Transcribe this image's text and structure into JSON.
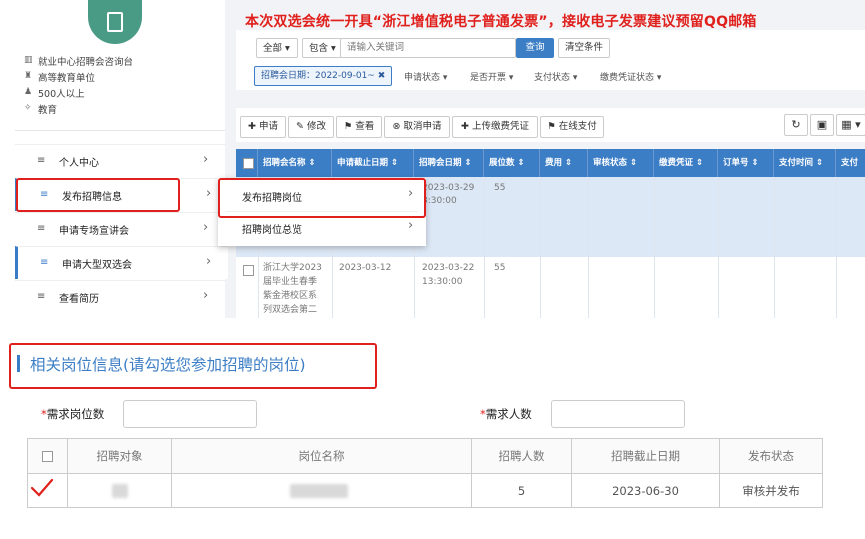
{
  "notice": "本次双选会统一开具“浙江增值税电子普通发票”，接收电子发票建议预留QQ邮箱",
  "sidebar": {
    "info": [
      {
        "icon": "building-icon",
        "glyph": "▥",
        "text": "就业中心招聘会咨询台"
      },
      {
        "icon": "graduation-cap-icon",
        "glyph": "♜",
        "text": "高等教育单位"
      },
      {
        "icon": "people-icon",
        "glyph": "♟",
        "text": "500人以上"
      },
      {
        "icon": "education-icon",
        "glyph": "✧",
        "text": "教育"
      }
    ],
    "menu": [
      {
        "label": "个人中心"
      },
      {
        "label": "发布招聘信息"
      },
      {
        "label": "申请专场宣讲会"
      },
      {
        "label": "申请大型双选会"
      },
      {
        "label": "查看简历"
      }
    ],
    "menu_icon_glyph": "≡",
    "chevron_glyph": "›"
  },
  "submenu": {
    "items": [
      "发布招聘岗位",
      "招聘岗位总览"
    ]
  },
  "search": {
    "scope": "全部 ▾",
    "match": "包含 ▾",
    "placeholder": "请输入关键词",
    "query_button": "查询",
    "clear_button": "清空条件",
    "active_filter": "招聘会日期：2022-09-01~ ✖",
    "filters": [
      "申请状态 ▾",
      "是否开票 ▾",
      "支付状态 ▾",
      "缴费凭证状态 ▾"
    ]
  },
  "toolbar": {
    "buttons": [
      "✚ 申请",
      "✎ 修改",
      "⚑ 查看",
      "⊗ 取消申请",
      "✚ 上传缴费凭证",
      "⚑ 在线支付"
    ],
    "icons": [
      "↻",
      "▣",
      "▦ ▾"
    ]
  },
  "grid": {
    "headers": [
      "招聘会名称",
      "申请截止日期",
      "招聘会日期",
      "展位数",
      "费用",
      "审核状态",
      "缴费凭证",
      "订单号",
      "支付时间",
      "支付"
    ],
    "sort_glyph": "⇕",
    "rows": [
      {
        "name": "",
        "deadline": "",
        "date": "2023-03-29",
        "time": "3:30:00",
        "booths": "55"
      },
      {
        "name": [
          "浙江大学2023",
          "届毕业生春季",
          "紫金港校区系",
          "列双选会第二"
        ],
        "deadline": "2023-03-12",
        "date": "2023-03-22",
        "time": "13:30:00",
        "booths": "55"
      }
    ]
  },
  "positions": {
    "title": "相关岗位信息(请勾选您参加招聘的岗位)",
    "need_position_label": "需求岗位数",
    "need_people_label": "需求人数",
    "required_mark": "*",
    "columns": [
      "招聘对象",
      "岗位名称",
      "招聘人数",
      "招聘截止日期",
      "发布状态"
    ],
    "rows": [
      {
        "target": "",
        "position": "",
        "count": "5",
        "deadline": "2023-06-30",
        "status": "审核并发布"
      }
    ]
  },
  "colors": {
    "accent": "#3c7ec6",
    "highlight_red": "#e0201c",
    "selected_row": "#dde8f6"
  }
}
